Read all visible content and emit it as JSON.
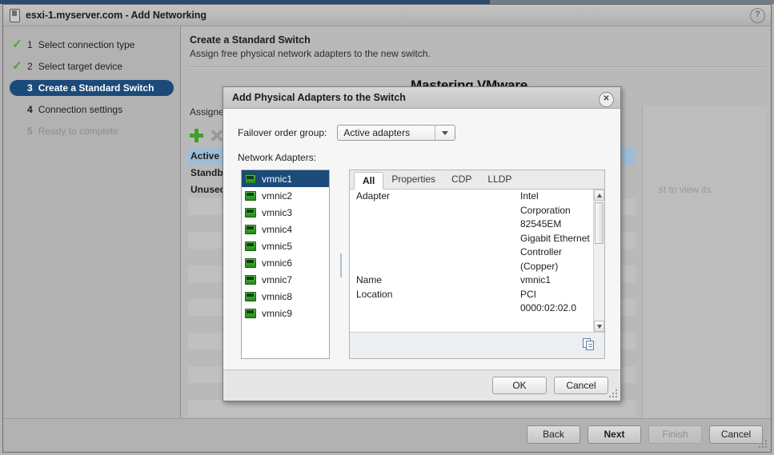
{
  "window": {
    "title": "esxi-1.myserver.com - Add Networking",
    "help_icon": "?",
    "app_icon": "server-icon"
  },
  "watermark": "Mastering VMware",
  "steps": [
    {
      "num": "1",
      "label": "Select connection type",
      "state": "done"
    },
    {
      "num": "2",
      "label": "Select target device",
      "state": "done"
    },
    {
      "num": "3",
      "label": "Create a Standard Switch",
      "state": "current"
    },
    {
      "num": "4",
      "label": "Connection settings",
      "state": "pending"
    },
    {
      "num": "5",
      "label": "Ready to complete",
      "state": "disabled"
    }
  ],
  "content": {
    "title": "Create a Standard Switch",
    "subtitle": "Assign free physical network adapters to the new switch.",
    "assigned_label": "Assigned adapters",
    "add_button": "+",
    "remove_button": "×",
    "groups": [
      {
        "label": "Active adapters",
        "selected": true
      },
      {
        "label": "Standby adapters",
        "selected": false
      },
      {
        "label": "Unused adapters",
        "selected": false
      }
    ],
    "right_help_text": "st to view its"
  },
  "footer": {
    "back": "Back",
    "next": "Next",
    "finish": "Finish",
    "cancel": "Cancel"
  },
  "dialog": {
    "title": "Add Physical Adapters to the Switch",
    "close_icon": "✕",
    "failover_label": "Failover order group:",
    "failover_value": "Active adapters",
    "network_adapters_label": "Network Adapters:",
    "adapters": [
      {
        "name": "vmnic1",
        "selected": true
      },
      {
        "name": "vmnic2",
        "selected": false
      },
      {
        "name": "vmnic3",
        "selected": false
      },
      {
        "name": "vmnic4",
        "selected": false
      },
      {
        "name": "vmnic5",
        "selected": false
      },
      {
        "name": "vmnic6",
        "selected": false
      },
      {
        "name": "vmnic7",
        "selected": false
      },
      {
        "name": "vmnic8",
        "selected": false
      },
      {
        "name": "vmnic9",
        "selected": false
      }
    ],
    "tabs": [
      {
        "label": "All",
        "active": true
      },
      {
        "label": "Properties",
        "active": false
      },
      {
        "label": "CDP",
        "active": false
      },
      {
        "label": "LLDP",
        "active": false
      }
    ],
    "details": [
      {
        "key": "Adapter",
        "value": "Intel Corporation 82545EM Gigabit Ethernet Controller (Copper)"
      },
      {
        "key": "Name",
        "value": "vmnic1"
      },
      {
        "key": "Location",
        "value": "PCI 0000:02:02.0"
      }
    ],
    "copy_icon": "copy-icon",
    "ok": "OK",
    "cancel": "Cancel"
  },
  "colors": {
    "selection_blue": "#1c4a79",
    "check_green": "#4aa635",
    "window_gray": "#b9b9b9",
    "dialog_bg": "#f6f6f6"
  }
}
